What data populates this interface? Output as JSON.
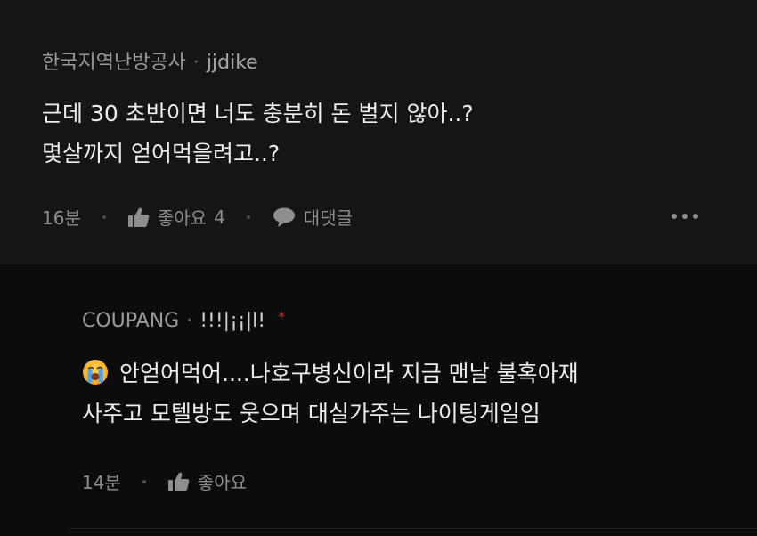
{
  "comments": [
    {
      "org": "한국지역난방공사",
      "separator": "·",
      "username": "jjdike",
      "lines": [
        "근데 30 초반이면 너도 충분히 돈 벌지 않아..?",
        "몇살까지 얻어먹을려고..?"
      ],
      "time": "16분",
      "like_label": "좋아요",
      "like_count": "4",
      "reply_label": "대댓글"
    },
    {
      "org": "COUPANG",
      "separator": "·",
      "username": "!!!|¡¡|l!",
      "author_mark": "*",
      "emoji": "loudly-crying-face",
      "lines": [
        "안얻어먹어....나호구병신이라 지금 맨날 불혹아재",
        "사주고 모텔방도 웃으며 대실가주는 나이팅게일임"
      ],
      "time": "14분",
      "like_label": "좋아요"
    }
  ]
}
